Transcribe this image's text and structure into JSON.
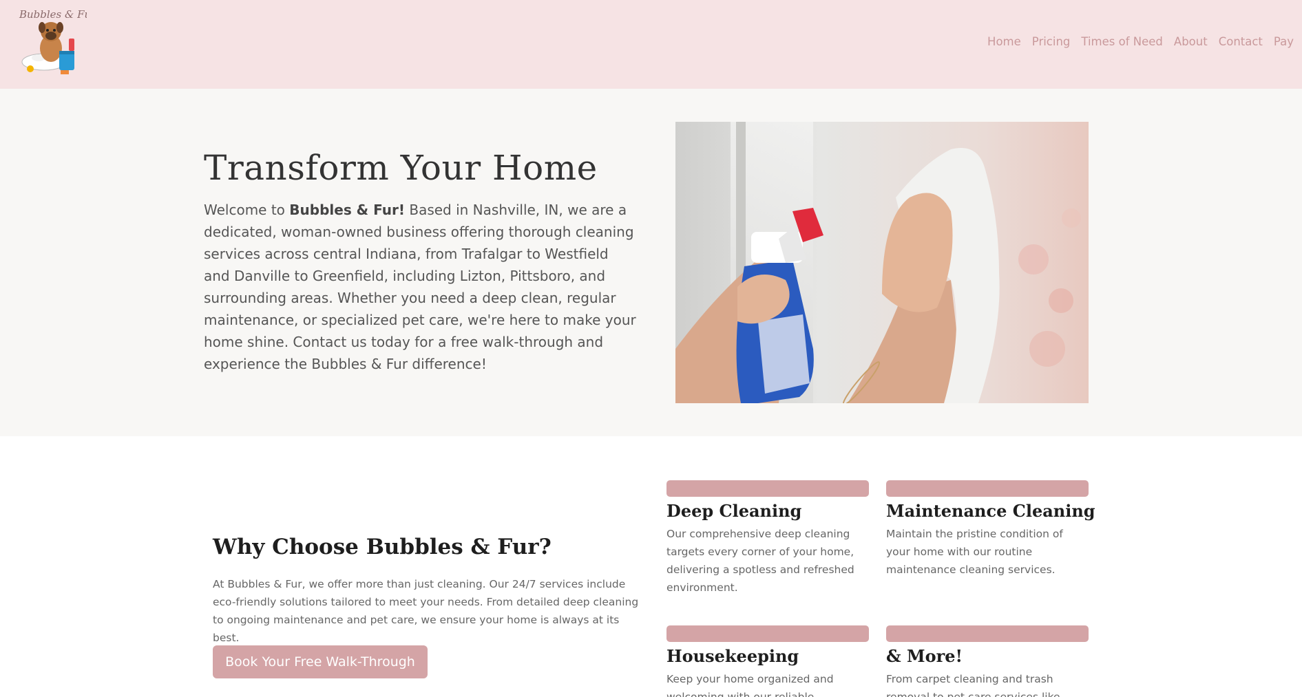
{
  "nav": {
    "items": [
      "Home",
      "Pricing",
      "Times of Need",
      "About",
      "Contact",
      "Pay"
    ]
  },
  "logo": {
    "text": "Bubbles & Fur"
  },
  "hero": {
    "title": "Transform Your Home",
    "intro_prefix": "Welcome to ",
    "brand": "Bubbles & Fur!",
    "intro_body": " Based in Nashville, IN, we are a dedicated, woman-owned business offering thorough cleaning services across central Indiana, from Trafalgar to Westfield and Danville to Greenfield, including Lizton, Pittsboro, and surrounding areas. Whether you need a deep clean, regular maintenance, or specialized pet care, we're here to make your home shine. Contact us today for a free walk-through and experience the Bubbles & Fur difference!"
  },
  "why": {
    "title": "Why Choose Bubbles & Fur?",
    "text": "At Bubbles & Fur, we offer more than just cleaning. Our 24/7 services include eco-friendly solutions tailored to meet your needs. From detailed deep cleaning to ongoing maintenance and pet care, we ensure your home is always at its best.",
    "cta": "Book Your Free Walk-Through"
  },
  "services": [
    {
      "title": "Deep Cleaning",
      "text": "Our comprehensive deep cleaning targets every corner of your home, delivering a spotless and refreshed environment."
    },
    {
      "title": "Maintenance Cleaning",
      "text": "Maintain the pristine condition of your home with our routine maintenance cleaning services."
    },
    {
      "title": "Housekeeping",
      "text": "Keep your home organized and welcoming with our reliable housekeeping services."
    },
    {
      "title": "& More!",
      "text": "From carpet cleaning and trash removal to pet care services like litter box cleaning, we do it all."
    }
  ],
  "colors": {
    "header_bg": "#f6e3e4",
    "hero_bg": "#f8f7f5",
    "accent": "#d4a4a6",
    "nav_text": "#c9999b"
  }
}
